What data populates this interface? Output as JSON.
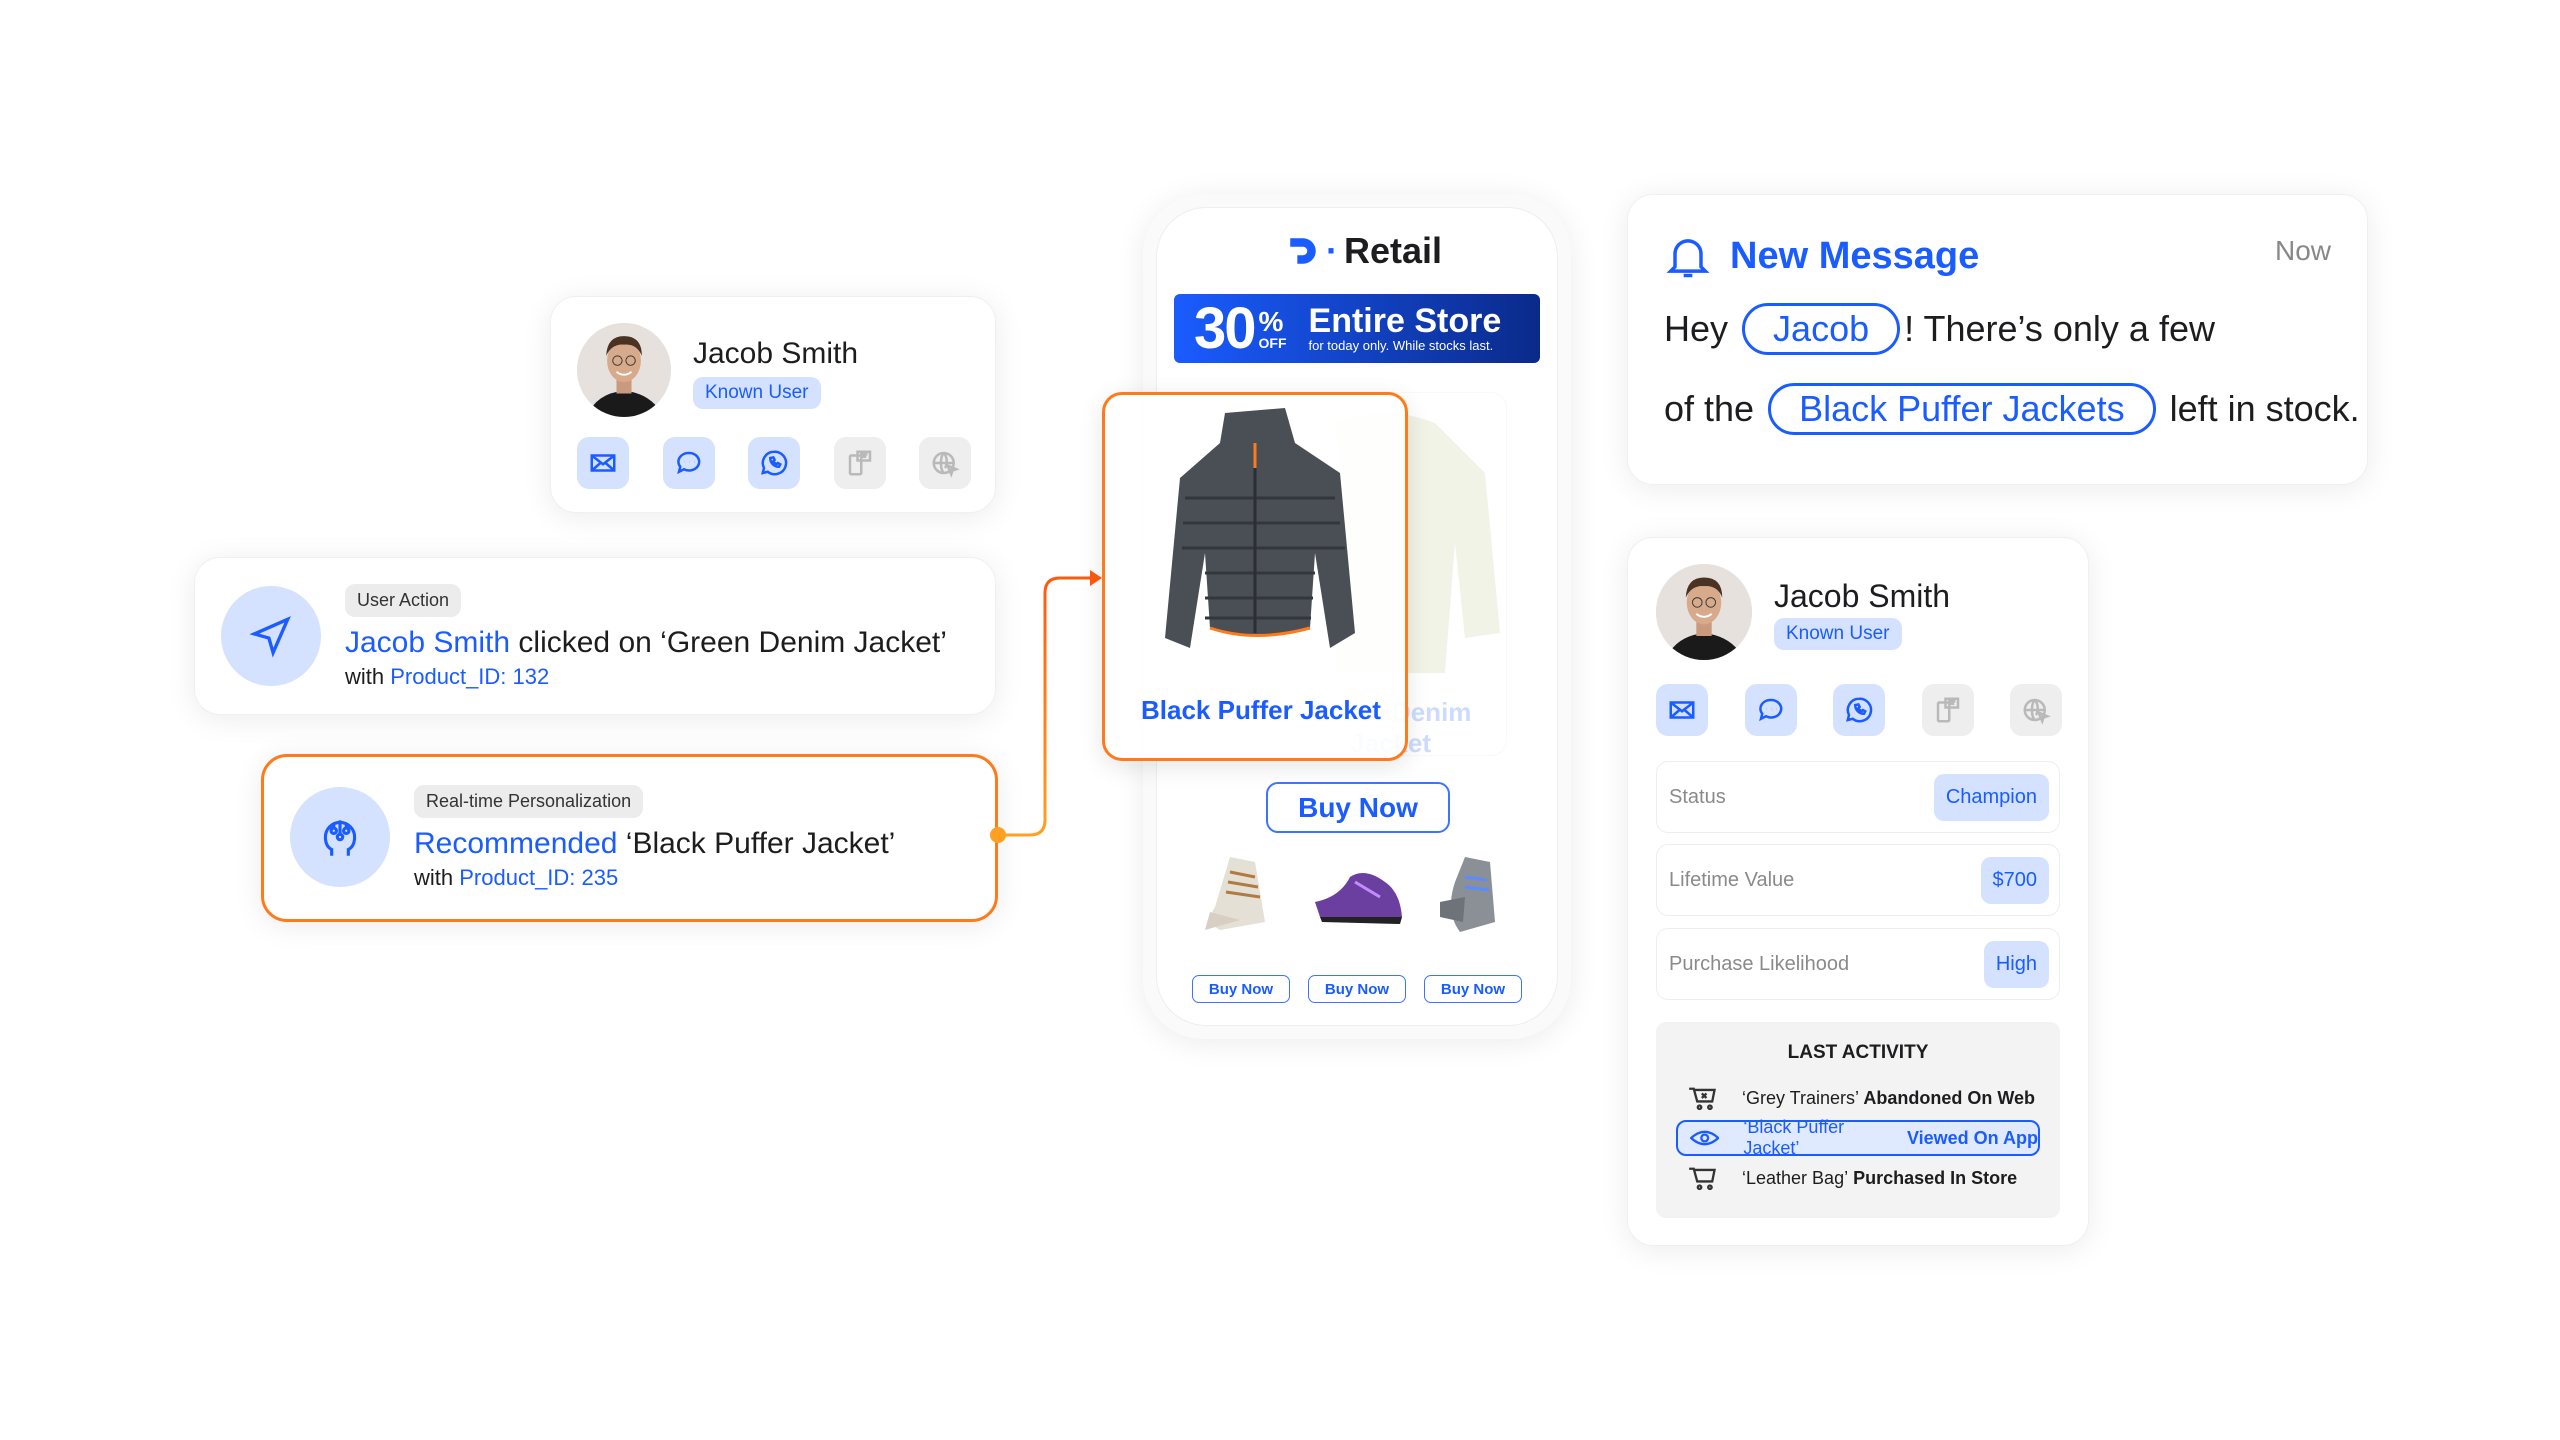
{
  "profile_card": {
    "name": "Jacob Smith",
    "badge": "Known User",
    "channels": [
      "email-icon",
      "chat-icon",
      "whatsapp-icon",
      "mobile-message-icon",
      "web-icon"
    ]
  },
  "user_action": {
    "tag": "User Action",
    "name": "Jacob Smith",
    "action": " clicked on ‘Green Denim Jacket’",
    "with": "with ",
    "product": "Product_ID: 132"
  },
  "personalization": {
    "tag": "Real-time Personalization",
    "action": "Recommended",
    "item": " ‘Black Puffer Jacket’",
    "with": "with ",
    "product": "Product_ID: 235"
  },
  "phone": {
    "brand": "Retail",
    "banner": {
      "percent": "30",
      "pct_sign": "%",
      "off": "OFF",
      "headline": "Entire Store",
      "sub": "for today only. While stocks last."
    },
    "featured": "Black Puffer Jacket",
    "background_item": "Green Denim Jacket",
    "buy_now": "Buy Now",
    "small_buttons": [
      "Buy Now",
      "Buy Now",
      "Buy Now"
    ]
  },
  "message": {
    "title": "New Message",
    "time": "Now",
    "line1_pre": "Hey",
    "name": "Jacob",
    "line1_post": "! There’s only a few",
    "line2_pre": "of the",
    "product": "Black Puffer Jackets",
    "line2_post": "left in stock."
  },
  "profile_detail": {
    "name": "Jacob Smith",
    "badge": "Known User",
    "attributes": [
      {
        "label": "Status",
        "value": "Champion"
      },
      {
        "label": "Lifetime Value",
        "value": "$700"
      },
      {
        "label": "Purchase Likelihood",
        "value": "High"
      }
    ],
    "last_activity_title": "LAST ACTIVITY",
    "activities": [
      {
        "item": "‘Grey Trainers’",
        "event": " Abandoned On Web",
        "icon": "cart-x-icon"
      },
      {
        "item": "‘Black Puffer Jacket’",
        "event": " Viewed On App",
        "icon": "eye-icon",
        "highlighted": true
      },
      {
        "item": "‘Leather Bag’",
        "event": " Purchased In Store",
        "icon": "cart-icon"
      }
    ]
  },
  "colors": {
    "accent": "#1a5cff",
    "highlight": "#ff7a1a",
    "badge_bg": "#d4e2ff"
  }
}
